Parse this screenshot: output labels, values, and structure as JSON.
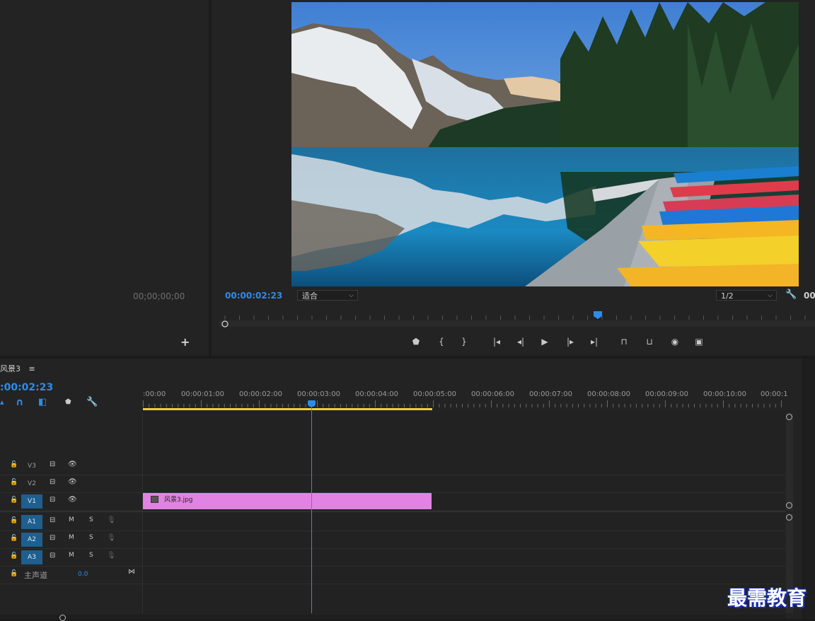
{
  "source_panel": {
    "timecode": "00;00;00;00",
    "add_icon": "plus-icon"
  },
  "program_monitor": {
    "timecode": "00:00:02:23",
    "zoom": "适合",
    "resolution": "1/2",
    "right_timecode_partial": "00",
    "playhead_position": 0.48
  },
  "transport": {
    "buttons": [
      {
        "name": "add-marker-button",
        "glyph": "⬟"
      },
      {
        "name": "mark-in-button",
        "glyph": "{"
      },
      {
        "name": "mark-out-button",
        "glyph": "}"
      },
      {
        "name": "go-to-in-button",
        "glyph": "|◂"
      },
      {
        "name": "step-back-button",
        "glyph": "◂|"
      },
      {
        "name": "play-button",
        "glyph": "▶"
      },
      {
        "name": "step-forward-button",
        "glyph": "|▸"
      },
      {
        "name": "go-to-out-button",
        "glyph": "▸|"
      },
      {
        "name": "lift-button",
        "glyph": "⊓"
      },
      {
        "name": "extract-button",
        "glyph": "⊔"
      },
      {
        "name": "export-frame-button",
        "glyph": "◉"
      },
      {
        "name": "compare-view-button",
        "glyph": "▣"
      }
    ]
  },
  "timeline": {
    "sequence_name": "风景3",
    "menu_icon": "≡",
    "timecode": ":00:02:23",
    "ruler": [
      ":00:00",
      "00:00:01:00",
      "00:00:02:00",
      "00:00:03:00",
      "00:00:04:00",
      "00:00:05:00",
      "00:00:06:00",
      "00:00:07:00",
      "00:00:08:00",
      "00:00:09:00",
      "00:00:10:00",
      "00:00:1"
    ],
    "video_tracks": [
      {
        "label": "V3",
        "targeted": false
      },
      {
        "label": "V2",
        "targeted": false
      },
      {
        "label": "V1",
        "targeted": true
      }
    ],
    "audio_tracks": [
      {
        "label": "A1",
        "mute": "M",
        "solo": "S"
      },
      {
        "label": "A2",
        "mute": "M",
        "solo": "S"
      },
      {
        "label": "A3",
        "mute": "M",
        "solo": "S"
      }
    ],
    "master": {
      "label": "主声道",
      "value": "0.0"
    },
    "clip": {
      "name": "风景3.jpg",
      "color": "#e383e1"
    },
    "playhead_color": "#2d8ceb",
    "work_area_color": "#e8d22f"
  },
  "watermark": "最需教育"
}
